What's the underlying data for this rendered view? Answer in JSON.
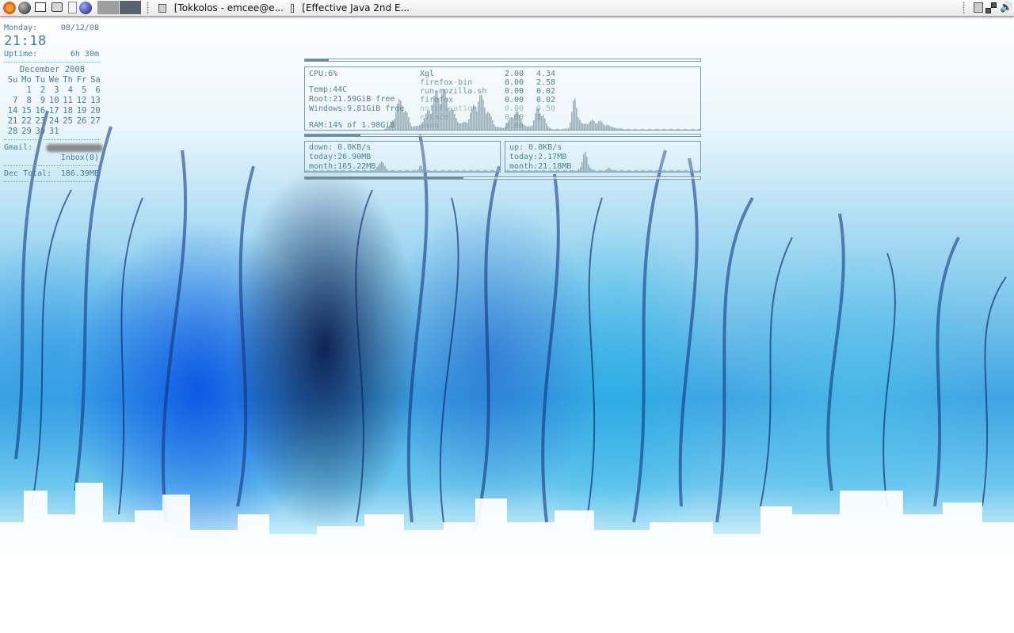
{
  "panel": {
    "launchers": [
      "ubuntu-icon",
      "browser-icon",
      "window-icon",
      "photo-icon",
      "document-icon",
      "globe-icon"
    ],
    "tasks": [
      {
        "title": "[Tokkolos - emcee@e..."
      },
      {
        "title": "[Effective Java 2nd E..."
      }
    ],
    "tray": [
      "tray-app-icon",
      "network-icon",
      "volume-icon"
    ],
    "colors": {
      "panel": "#ececec",
      "workspace_inactive": "#9e9e9e",
      "workspace_active": "#58636e"
    }
  },
  "conky_left": {
    "day": "Monday:",
    "date": "08/12/08",
    "time": "21:18",
    "uptime_label": "Uptime:",
    "uptime_value": "6h 30m",
    "calendar": {
      "title": "December 2008",
      "weekdays": [
        "Su",
        "Mo",
        "Tu",
        "We",
        "Th",
        "Fr",
        "Sa"
      ],
      "weeks": [
        [
          "",
          "1",
          "2",
          "3",
          "4",
          "5",
          "6"
        ],
        [
          "7",
          "8",
          "9",
          "10",
          "11",
          "12",
          "13"
        ],
        [
          "14",
          "15",
          "16",
          "17",
          "18",
          "19",
          "20"
        ],
        [
          "21",
          "22",
          "23",
          "24",
          "25",
          "26",
          "27"
        ],
        [
          "28",
          "29",
          "30",
          "31",
          "",
          "",
          ""
        ]
      ]
    },
    "gmail_label": "Gmail:",
    "inbox": "Inbox(0)",
    "total_label": "Dec Total:",
    "total_value": "186.39MB"
  },
  "system": {
    "cpu_label": "CPU:6%",
    "cpu_percent": 6,
    "temp": "Temp:44C",
    "root": "Root:21.59GiB free",
    "windows": "Windows:9.81GiB free",
    "ram": "RAM:14% of 1.98GiB",
    "ram_percent": 14,
    "disk_percent": 40,
    "processes": [
      {
        "name": "Xgl",
        "cpu": "2.00",
        "mem": "4.34"
      },
      {
        "name": "firefox-bin",
        "cpu": "0.00",
        "mem": "2.58"
      },
      {
        "name": "run-mozilla.sh",
        "cpu": "0.00",
        "mem": "0.02"
      },
      {
        "name": "firefox",
        "cpu": "0.00",
        "mem": "0.02"
      },
      {
        "name": "notification",
        "cpu": "0.00",
        "mem": "0.50"
      },
      {
        "name": "evince",
        "cpu": "0.00",
        "mem": "1"
      },
      {
        "name": "bash",
        "cpu": "0.00",
        "mem": ""
      }
    ]
  },
  "network": {
    "down": "down:  0.0KB/s",
    "down_today": "today:26.90MB",
    "down_month": "month:165.22MB",
    "up": "up:    0.0KB/s",
    "up_today": "today:2.17MB",
    "up_month": "month:21.18MB"
  }
}
